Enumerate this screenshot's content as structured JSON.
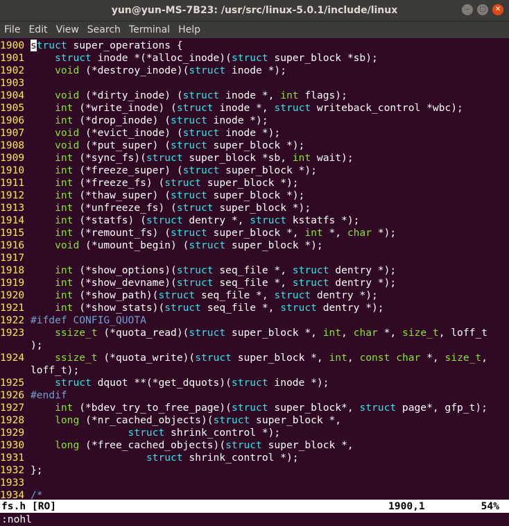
{
  "window": {
    "title": "yun@yun-MS-7B23: /usr/src/linux-5.0.1/include/linux"
  },
  "menu": [
    "File",
    "Edit",
    "View",
    "Search",
    "Terminal",
    "Help"
  ],
  "lines": [
    [
      [
        "ln",
        "1900 "
      ],
      [
        "cur",
        "s"
      ],
      [
        "kw",
        "truct"
      ],
      [
        "n",
        " super_operations {"
      ]
    ],
    [
      [
        "ln",
        "1901 "
      ],
      [
        "n",
        "    "
      ],
      [
        "kw",
        "struct"
      ],
      [
        "n",
        " inode *(*alloc_inode)("
      ],
      [
        "kw",
        "struct"
      ],
      [
        "n",
        " super_block *sb);"
      ]
    ],
    [
      [
        "ln",
        "1902 "
      ],
      [
        "n",
        "    "
      ],
      [
        "tp",
        "void"
      ],
      [
        "n",
        " (*destroy_inode)("
      ],
      [
        "kw",
        "struct"
      ],
      [
        "n",
        " inode *);"
      ]
    ],
    [
      [
        "ln",
        "1903 "
      ]
    ],
    [
      [
        "ln",
        "1904 "
      ],
      [
        "n",
        "    "
      ],
      [
        "tp",
        "void"
      ],
      [
        "n",
        " (*dirty_inode) ("
      ],
      [
        "kw",
        "struct"
      ],
      [
        "n",
        " inode *, "
      ],
      [
        "tp",
        "int"
      ],
      [
        "n",
        " flags);"
      ]
    ],
    [
      [
        "ln",
        "1905 "
      ],
      [
        "n",
        "    "
      ],
      [
        "tp",
        "int"
      ],
      [
        "n",
        " (*write_inode) ("
      ],
      [
        "kw",
        "struct"
      ],
      [
        "n",
        " inode *, "
      ],
      [
        "kw",
        "struct"
      ],
      [
        "n",
        " writeback_control *wbc);"
      ]
    ],
    [
      [
        "ln",
        "1906 "
      ],
      [
        "n",
        "    "
      ],
      [
        "tp",
        "int"
      ],
      [
        "n",
        " (*drop_inode) ("
      ],
      [
        "kw",
        "struct"
      ],
      [
        "n",
        " inode *);"
      ]
    ],
    [
      [
        "ln",
        "1907 "
      ],
      [
        "n",
        "    "
      ],
      [
        "tp",
        "void"
      ],
      [
        "n",
        " (*evict_inode) ("
      ],
      [
        "kw",
        "struct"
      ],
      [
        "n",
        " inode *);"
      ]
    ],
    [
      [
        "ln",
        "1908 "
      ],
      [
        "n",
        "    "
      ],
      [
        "tp",
        "void"
      ],
      [
        "n",
        " (*put_super) ("
      ],
      [
        "kw",
        "struct"
      ],
      [
        "n",
        " super_block *);"
      ]
    ],
    [
      [
        "ln",
        "1909 "
      ],
      [
        "n",
        "    "
      ],
      [
        "tp",
        "int"
      ],
      [
        "n",
        " (*sync_fs)("
      ],
      [
        "kw",
        "struct"
      ],
      [
        "n",
        " super_block *sb, "
      ],
      [
        "tp",
        "int"
      ],
      [
        "n",
        " wait);"
      ]
    ],
    [
      [
        "ln",
        "1910 "
      ],
      [
        "n",
        "    "
      ],
      [
        "tp",
        "int"
      ],
      [
        "n",
        " (*freeze_super) ("
      ],
      [
        "kw",
        "struct"
      ],
      [
        "n",
        " super_block *);"
      ]
    ],
    [
      [
        "ln",
        "1911 "
      ],
      [
        "n",
        "    "
      ],
      [
        "tp",
        "int"
      ],
      [
        "n",
        " (*freeze_fs) ("
      ],
      [
        "kw",
        "struct"
      ],
      [
        "n",
        " super_block *);"
      ]
    ],
    [
      [
        "ln",
        "1912 "
      ],
      [
        "n",
        "    "
      ],
      [
        "tp",
        "int"
      ],
      [
        "n",
        " (*thaw_super) ("
      ],
      [
        "kw",
        "struct"
      ],
      [
        "n",
        " super_block *);"
      ]
    ],
    [
      [
        "ln",
        "1913 "
      ],
      [
        "n",
        "    "
      ],
      [
        "tp",
        "int"
      ],
      [
        "n",
        " (*unfreeze_fs) ("
      ],
      [
        "kw",
        "struct"
      ],
      [
        "n",
        " super_block *);"
      ]
    ],
    [
      [
        "ln",
        "1914 "
      ],
      [
        "n",
        "    "
      ],
      [
        "tp",
        "int"
      ],
      [
        "n",
        " (*statfs) ("
      ],
      [
        "kw",
        "struct"
      ],
      [
        "n",
        " dentry *, "
      ],
      [
        "kw",
        "struct"
      ],
      [
        "n",
        " kstatfs *);"
      ]
    ],
    [
      [
        "ln",
        "1915 "
      ],
      [
        "n",
        "    "
      ],
      [
        "tp",
        "int"
      ],
      [
        "n",
        " (*remount_fs) ("
      ],
      [
        "kw",
        "struct"
      ],
      [
        "n",
        " super_block *, "
      ],
      [
        "tp",
        "int"
      ],
      [
        "n",
        " *, "
      ],
      [
        "tp",
        "char"
      ],
      [
        "n",
        " *);"
      ]
    ],
    [
      [
        "ln",
        "1916 "
      ],
      [
        "n",
        "    "
      ],
      [
        "tp",
        "void"
      ],
      [
        "n",
        " (*umount_begin) ("
      ],
      [
        "kw",
        "struct"
      ],
      [
        "n",
        " super_block *);"
      ]
    ],
    [
      [
        "ln",
        "1917 "
      ]
    ],
    [
      [
        "ln",
        "1918 "
      ],
      [
        "n",
        "    "
      ],
      [
        "tp",
        "int"
      ],
      [
        "n",
        " (*show_options)("
      ],
      [
        "kw",
        "struct"
      ],
      [
        "n",
        " seq_file *, "
      ],
      [
        "kw",
        "struct"
      ],
      [
        "n",
        " dentry *);"
      ]
    ],
    [
      [
        "ln",
        "1919 "
      ],
      [
        "n",
        "    "
      ],
      [
        "tp",
        "int"
      ],
      [
        "n",
        " (*show_devname)("
      ],
      [
        "kw",
        "struct"
      ],
      [
        "n",
        " seq_file *, "
      ],
      [
        "kw",
        "struct"
      ],
      [
        "n",
        " dentry *);"
      ]
    ],
    [
      [
        "ln",
        "1920 "
      ],
      [
        "n",
        "    "
      ],
      [
        "tp",
        "int"
      ],
      [
        "n",
        " (*show_path)("
      ],
      [
        "kw",
        "struct"
      ],
      [
        "n",
        " seq_file *, "
      ],
      [
        "kw",
        "struct"
      ],
      [
        "n",
        " dentry *);"
      ]
    ],
    [
      [
        "ln",
        "1921 "
      ],
      [
        "n",
        "    "
      ],
      [
        "tp",
        "int"
      ],
      [
        "n",
        " (*show_stats)("
      ],
      [
        "kw",
        "struct"
      ],
      [
        "n",
        " seq_file *, "
      ],
      [
        "kw",
        "struct"
      ],
      [
        "n",
        " dentry *);"
      ]
    ],
    [
      [
        "ln",
        "1922 "
      ],
      [
        "pp",
        "#ifdef CONFIG_QUOTA"
      ]
    ],
    [
      [
        "ln",
        "1923 "
      ],
      [
        "n",
        "    "
      ],
      [
        "tp",
        "ssize_t"
      ],
      [
        "n",
        " (*quota_read)("
      ],
      [
        "kw",
        "struct"
      ],
      [
        "n",
        " super_block *, "
      ],
      [
        "tp",
        "int"
      ],
      [
        "n",
        ", "
      ],
      [
        "tp",
        "char"
      ],
      [
        "n",
        " *, "
      ],
      [
        "tp",
        "size_t"
      ],
      [
        "n",
        ", loff_t"
      ]
    ],
    [
      [
        "ln",
        "     "
      ],
      [
        "n",
        ");"
      ]
    ],
    [
      [
        "ln",
        "1924 "
      ],
      [
        "n",
        "    "
      ],
      [
        "tp",
        "ssize_t"
      ],
      [
        "n",
        " (*quota_write)("
      ],
      [
        "kw",
        "struct"
      ],
      [
        "n",
        " super_block *, "
      ],
      [
        "tp",
        "int"
      ],
      [
        "n",
        ", "
      ],
      [
        "tp",
        "const"
      ],
      [
        "n",
        " "
      ],
      [
        "tp",
        "char"
      ],
      [
        "n",
        " *, "
      ],
      [
        "tp",
        "size_t"
      ],
      [
        "n",
        ","
      ]
    ],
    [
      [
        "ln",
        "     "
      ],
      [
        "n",
        "loff_t);"
      ]
    ],
    [
      [
        "ln",
        "1925 "
      ],
      [
        "n",
        "    "
      ],
      [
        "kw",
        "struct"
      ],
      [
        "n",
        " dquot **(*get_dquots)("
      ],
      [
        "kw",
        "struct"
      ],
      [
        "n",
        " inode *);"
      ]
    ],
    [
      [
        "ln",
        "1926 "
      ],
      [
        "pp",
        "#endif"
      ]
    ],
    [
      [
        "ln",
        "1927 "
      ],
      [
        "n",
        "    "
      ],
      [
        "tp",
        "int"
      ],
      [
        "n",
        " (*bdev_try_to_free_page)("
      ],
      [
        "kw",
        "struct"
      ],
      [
        "n",
        " super_block*, "
      ],
      [
        "kw",
        "struct"
      ],
      [
        "n",
        " page*, gfp_t);"
      ]
    ],
    [
      [
        "ln",
        "1928 "
      ],
      [
        "n",
        "    "
      ],
      [
        "tp",
        "long"
      ],
      [
        "n",
        " (*nr_cached_objects)("
      ],
      [
        "kw",
        "struct"
      ],
      [
        "n",
        " super_block *,"
      ]
    ],
    [
      [
        "ln",
        "1929 "
      ],
      [
        "n",
        "                "
      ],
      [
        "kw",
        "struct"
      ],
      [
        "n",
        " shrink_control *);"
      ]
    ],
    [
      [
        "ln",
        "1930 "
      ],
      [
        "n",
        "    "
      ],
      [
        "tp",
        "long"
      ],
      [
        "n",
        " (*free_cached_objects)("
      ],
      [
        "kw",
        "struct"
      ],
      [
        "n",
        " super_block *,"
      ]
    ],
    [
      [
        "ln",
        "1931 "
      ],
      [
        "n",
        "                   "
      ],
      [
        "kw",
        "struct"
      ],
      [
        "n",
        " shrink_control *);"
      ]
    ],
    [
      [
        "ln",
        "1932 "
      ],
      [
        "n",
        "};"
      ]
    ],
    [
      [
        "ln",
        "1933 "
      ]
    ],
    [
      [
        "ln",
        "1934 "
      ],
      [
        "pp",
        "/*"
      ]
    ]
  ],
  "status": {
    "file": "fs.h [RO]",
    "position": "1900,1",
    "percent": "54%"
  },
  "cmdline": ":nohl",
  "colors": {
    "background": "#300a24",
    "line_number": "#fce94f",
    "keyword": "#34e2e2",
    "type": "#8ae234",
    "preproc": "#729fcf"
  }
}
